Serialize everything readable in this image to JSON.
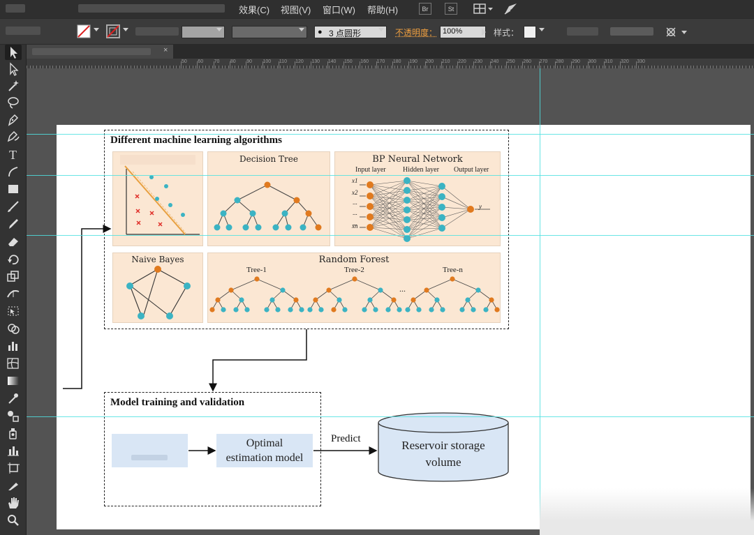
{
  "menubar": {
    "items": [
      "效果(C)",
      "视图(V)",
      "窗口(W)",
      "帮助(H)"
    ],
    "badges": [
      "Br",
      "St"
    ]
  },
  "controlbar": {
    "stroke_size_label": "3 点圆形",
    "opacity_label": "不透明度：",
    "opacity_value": "100%",
    "style_label": "样式："
  },
  "ruler_numbers": [
    "50",
    "60",
    "70",
    "80",
    "90",
    "100",
    "110",
    "120",
    "130",
    "140",
    "150",
    "160",
    "170",
    "180",
    "190",
    "200",
    "210",
    "220",
    "230",
    "240",
    "250",
    "260",
    "270",
    "280",
    "290",
    "300",
    "310",
    "320",
    "330"
  ],
  "diagram": {
    "top_box_title": "Different machine learning algorithms",
    "panels": {
      "decision_tree": "Decision Tree",
      "bp_network": "BP Neural Network",
      "input_layer": "Input layer",
      "hidden_layer": "Hidden layer",
      "output_layer": "Output layer",
      "output_symbol": "y",
      "input_symbols": [
        "x1",
        "x2",
        "...",
        "...",
        "...",
        "xn"
      ],
      "naive_bayes": "Naive Bayes",
      "random_forest": "Random Forest",
      "tree_1": "Tree-1",
      "tree_2": "Tree-2",
      "tree_n": "Tree-n",
      "ellipsis": "..."
    },
    "bottom_box_title": "Model training and validation",
    "optimal_model_line1": "Optimal",
    "optimal_model_line2": "estimation model",
    "predict_label": "Predict",
    "reservoir_line1": "Reservoir storage",
    "reservoir_line2": "volume"
  },
  "colors": {
    "panel_bg": "#fbe7d3",
    "node_teal": "#3bb3c3",
    "node_orange": "#e07a1f",
    "svm_line": "#e8a040",
    "svm_cross": "#e0302a",
    "light_blue": "#d9e6f5"
  }
}
